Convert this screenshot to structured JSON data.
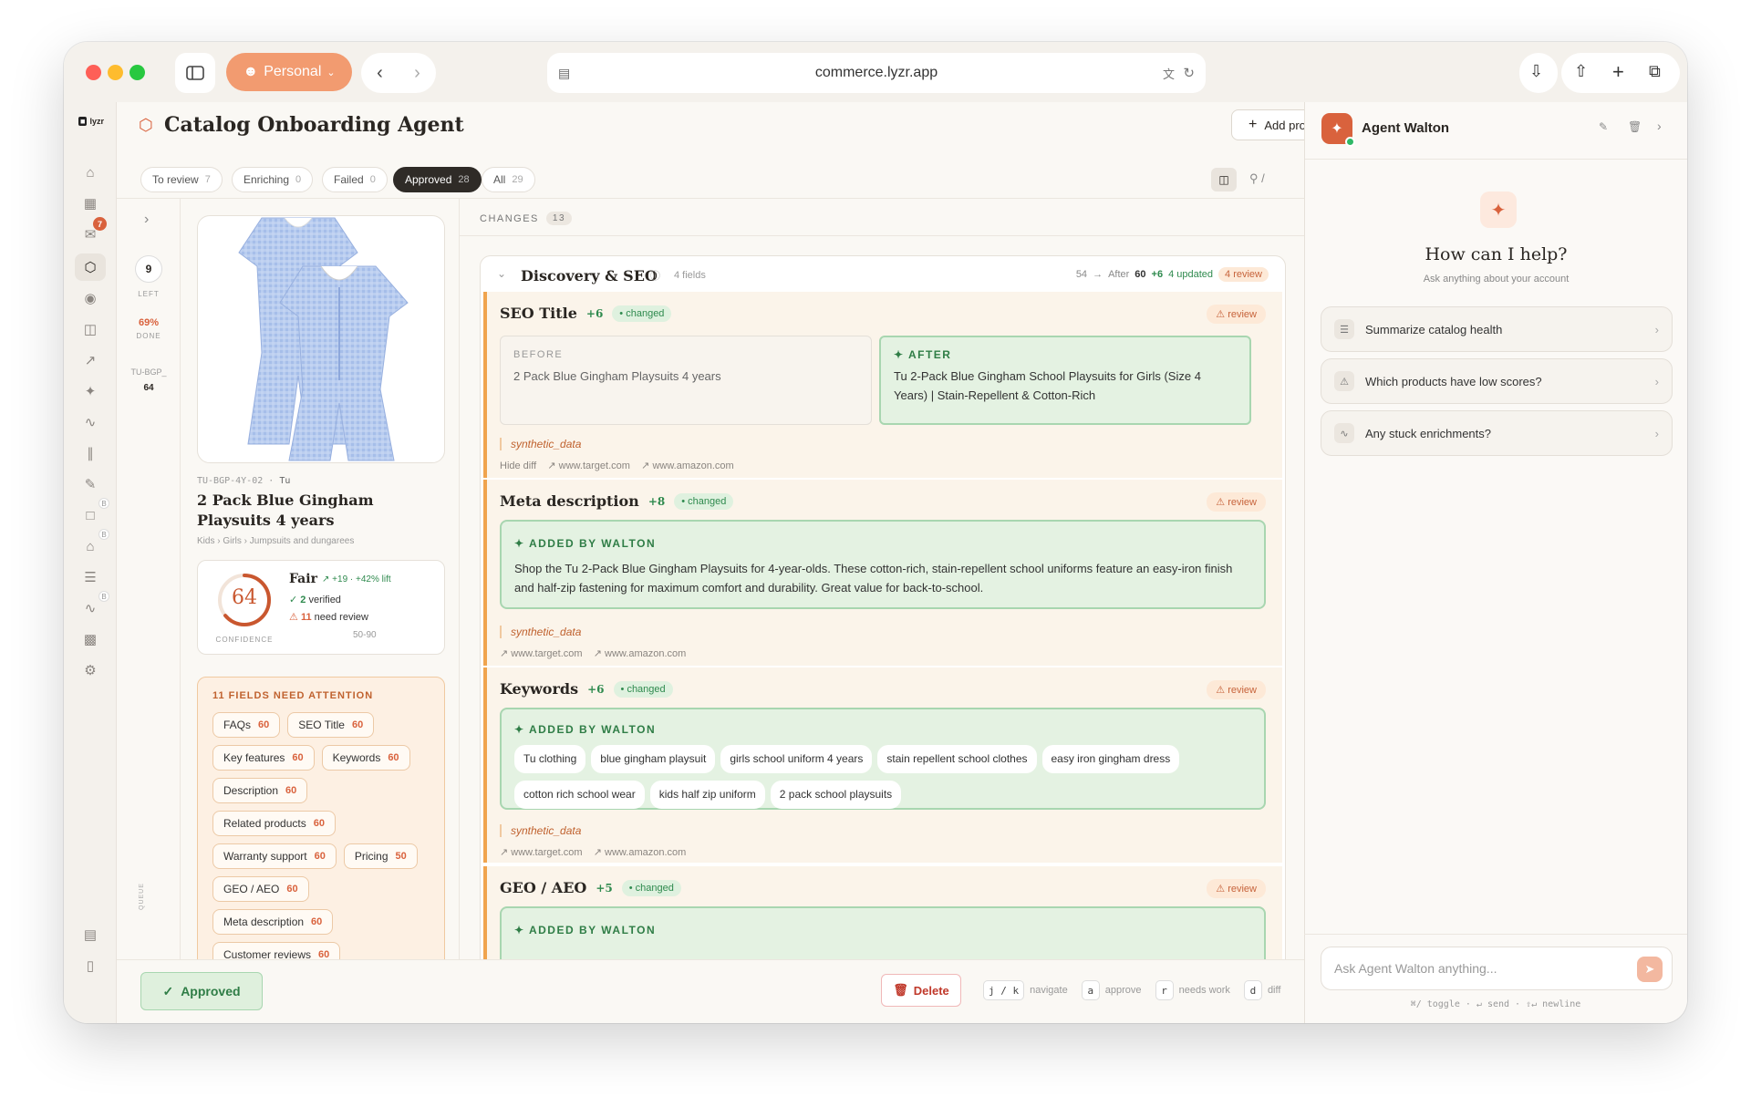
{
  "browser": {
    "profile": "Personal",
    "url": "commerce.lyzr.app"
  },
  "nav": {
    "logo": "lyzr",
    "inbox_badge": "7",
    "badge_b": "B"
  },
  "page": {
    "title": "Catalog Onboarding Agent",
    "add_products": "Add products"
  },
  "filters": [
    {
      "label": "To review",
      "count": "7"
    },
    {
      "label": "Enriching",
      "count": "0"
    },
    {
      "label": "Failed",
      "count": "0"
    },
    {
      "label": "Approved",
      "count": "28"
    },
    {
      "label": "All",
      "count": "29"
    }
  ],
  "search_hint": "/",
  "queue": {
    "left_num": "9",
    "left_label": "LEFT",
    "done_pct": "69%",
    "done_label": "DONE",
    "sku_short": "TU-BGP_",
    "score": "64",
    "queue_label": "QUEUE"
  },
  "product": {
    "sku": "TU-BGP-4Y-02",
    "brand": "Tu",
    "name": "2 Pack Blue Gingham Playsuits 4 years",
    "breadcrumb": [
      "Kids",
      "Girls",
      "Jumpsuits and dungarees"
    ],
    "confidence": {
      "value": "64",
      "ratio": 0.64,
      "label": "CONFIDENCE",
      "grade": "Fair",
      "lift": "+19 · +42% lift",
      "verified_n": "2",
      "verified": "verified",
      "review_n": "11",
      "review": "need review",
      "range": "50-90"
    }
  },
  "attention": {
    "title": "11 FIELDS NEED ATTENTION",
    "fields": [
      {
        "name": "FAQs",
        "score": "60"
      },
      {
        "name": "SEO Title",
        "score": "60"
      },
      {
        "name": "Key features",
        "score": "60"
      },
      {
        "name": "Keywords",
        "score": "60"
      },
      {
        "name": "Description",
        "score": "60"
      },
      {
        "name": "Related products",
        "score": "60"
      },
      {
        "name": "Warranty support",
        "score": "60"
      },
      {
        "name": "Pricing",
        "score": "50"
      },
      {
        "name": "GEO / AEO",
        "score": "60"
      },
      {
        "name": "Meta description",
        "score": "60"
      },
      {
        "name": "Customer reviews",
        "score": "60"
      }
    ]
  },
  "changes": {
    "label": "CHANGES",
    "count": "13"
  },
  "section": {
    "title": "Discovery & SEO",
    "fields": "4 fields",
    "before": "54",
    "after_label": "After",
    "after": "60",
    "delta": "+6",
    "updated": "4 updated",
    "review": "4 review"
  },
  "labels": {
    "changed": "changed",
    "review": "review",
    "before": "BEFORE",
    "after": "AFTER",
    "added": "ADDED BY WALTON",
    "synthetic": "synthetic_data",
    "hide_diff": "Hide diff",
    "src1": "www.target.com",
    "src2": "www.amazon.com"
  },
  "seo_title": {
    "name": "SEO Title",
    "delta": "+6",
    "before": "2 Pack Blue Gingham Playsuits 4 years",
    "after": "Tu 2-Pack Blue Gingham School Playsuits for Girls (Size 4 Years) | Stain-Repellent & Cotton-Rich"
  },
  "meta": {
    "name": "Meta description",
    "delta": "+8",
    "text": "Shop the Tu 2-Pack Blue Gingham Playsuits for 4-year-olds. These cotton-rich, stain-repellent school uniforms feature an easy-iron finish and half-zip fastening for maximum comfort and durability. Great value for back-to-school."
  },
  "keywords": {
    "name": "Keywords",
    "delta": "+6",
    "items": [
      "Tu clothing",
      "blue gingham playsuit",
      "girls school uniform 4 years",
      "stain repellent school clothes",
      "easy iron gingham dress",
      "cotton rich school wear",
      "kids half zip uniform",
      "2 pack school playsuits"
    ]
  },
  "geo": {
    "name": "GEO / AEO",
    "delta": "+5"
  },
  "footer": {
    "approved": "Approved",
    "delete": "Delete",
    "k1": "j / k",
    "h1": "navigate",
    "k2": "a",
    "h2": "approve",
    "k3": "r",
    "h3": "needs work",
    "k4": "d",
    "h4": "diff"
  },
  "agent": {
    "name": "Agent Walton",
    "help": "How can I help?",
    "sub": "Ask anything about your account",
    "suggestions": [
      "Summarize catalog health",
      "Which products have low scores?",
      "Any stuck enrichments?"
    ],
    "placeholder": "Ask Agent Walton anything...",
    "hint": "⌘/ toggle · ↵ send · ⇧↵ newline"
  },
  "colors": {
    "accent": "#d9623d",
    "approved": "#2f8a4e",
    "warn": "#f0a44e"
  }
}
